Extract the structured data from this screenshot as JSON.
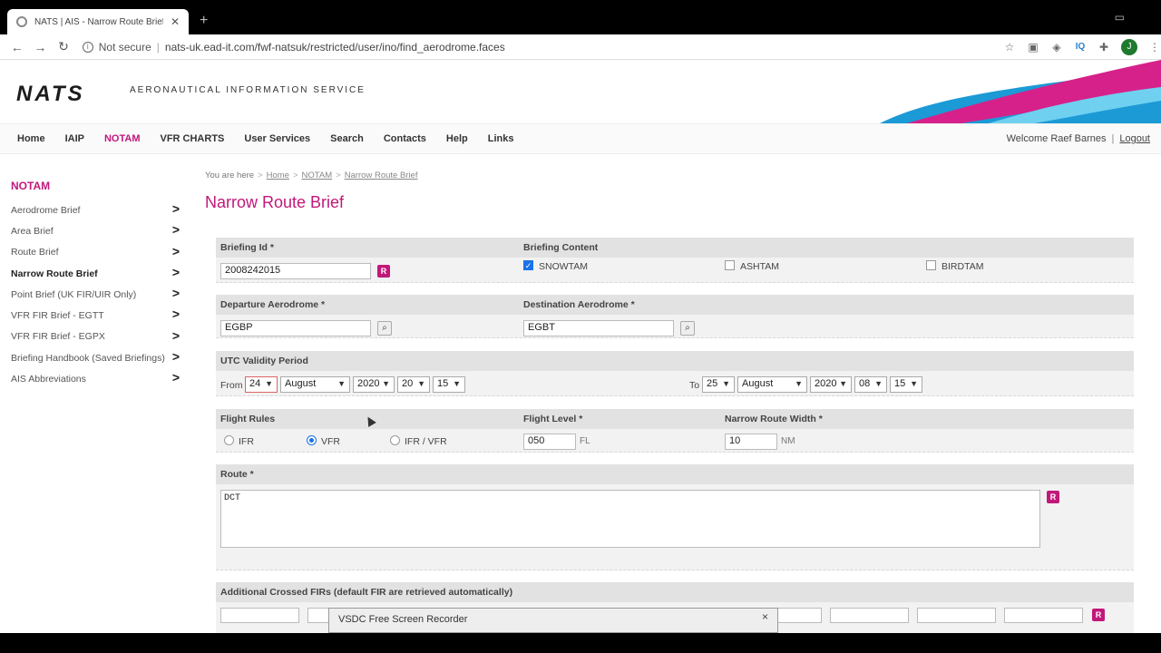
{
  "browser": {
    "tab_title": "NATS | AIS - Narrow Route Brief",
    "new_tab": "+",
    "not_secure": "Not secure",
    "url": "nats-uk.ead-it.com/fwf-natsuk/restricted/user/ino/find_aerodrome.faces",
    "profile_initial": "J",
    "ext_iq": "IQ"
  },
  "header": {
    "logo": "NATS",
    "subtitle": "AERONAUTICAL INFORMATION SERVICE",
    "accent_color": "#c2187a"
  },
  "topnav": {
    "items": [
      "Home",
      "IAIP",
      "NOTAM",
      "VFR CHARTS",
      "User Services",
      "Search",
      "Contacts",
      "Help",
      "Links"
    ],
    "active": "NOTAM",
    "welcome": "Welcome Raef Barnes",
    "logout": "Logout"
  },
  "sidebar": {
    "title": "NOTAM",
    "items": [
      "Aerodrome Brief",
      "Area Brief",
      "Route Brief",
      "Narrow Route Brief",
      "Point Brief (UK FIR/UIR Only)",
      "VFR FIR Brief - EGTT",
      "VFR FIR Brief - EGPX",
      "Briefing Handbook (Saved Briefings)",
      "AIS Abbreviations"
    ],
    "arrow": ">"
  },
  "breadcrumb": {
    "prefix": "You are here",
    "items": [
      "Home",
      "NOTAM",
      "Narrow Route Brief"
    ]
  },
  "page_title": "Narrow Route Brief",
  "form": {
    "briefing_id_label": "Briefing Id *",
    "briefing_id_value": "2008242015",
    "briefing_content_label": "Briefing Content",
    "snowtam": "SNOWTAM",
    "ashtam": "ASHTAM",
    "birdtam": "BIRDTAM",
    "departure_label": "Departure Aerodrome *",
    "departure_value": "EGBP",
    "destination_label": "Destination Aerodrome *",
    "destination_value": "EGBT",
    "validity_label": "UTC Validity Period",
    "from_label": "From",
    "from": {
      "day": "24",
      "month": "August",
      "year": "2020",
      "hour": "20",
      "minute": "15"
    },
    "to_label": "To",
    "to": {
      "day": "25",
      "month": "August",
      "year": "2020",
      "hour": "08",
      "minute": "15"
    },
    "flight_rules_label": "Flight Rules",
    "rule_ifr": "IFR",
    "rule_vfr": "VFR",
    "rule_ifr_vfr": "IFR / VFR",
    "flight_level_label": "Flight Level *",
    "flight_level_value": "050",
    "flight_level_unit": "FL",
    "width_label": "Narrow Route Width *",
    "width_value": "10",
    "width_unit": "NM",
    "route_label": "Route *",
    "route_value": "DCT",
    "firs_label": "Additional Crossed FIRs (default FIR are retrieved automatically)",
    "r_button": "R"
  },
  "recorder": {
    "title": "VSDC Free Screen Recorder",
    "close": "×"
  }
}
